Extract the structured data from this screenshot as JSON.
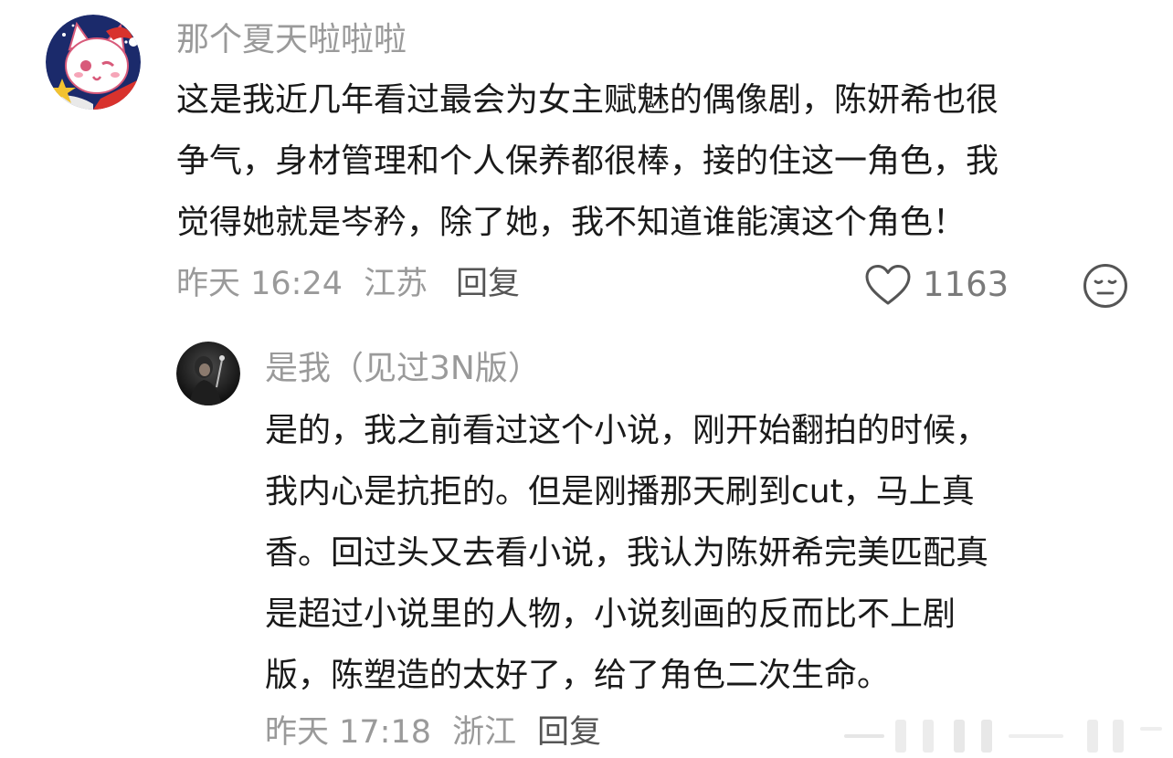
{
  "comment": {
    "username": "那个夏天啦啦啦",
    "lines": [
      "这是我近几年看过最会为女主赋魅的偶像剧，陈妍希也很",
      "争气，身材管理和个人保养都很棒，接的住这一角色，我",
      "觉得她就是岑矜，除了她，我不知道谁能演这个角色！"
    ],
    "time": "昨天 16:24",
    "location": "江苏",
    "reply_label": "回复",
    "like_count": "1163",
    "avatar_icon": "cat-avatar-icon",
    "like_icon": "heart-icon",
    "emoji_icon": "neutral-face-icon"
  },
  "reply": {
    "username": "是我（见过3N版）",
    "lines": [
      "是的，我之前看过这个小说，刚开始翻拍的时候，",
      "我内心是抗拒的。但是刚播那天刷到cut，马上真",
      "香。回过头又去看小说，我认为陈妍希完美匹配真",
      "是超过小说里的人物，小说刻画的反而比不上剧",
      "版，陈塑造的太好了，给了角色二次生命。"
    ],
    "time": "昨天 17:18",
    "location": "浙江",
    "reply_label": "回复",
    "avatar_icon": "photo-avatar-icon"
  },
  "colors": {
    "text": "#1a1a1a",
    "meta": "#9a9a9a",
    "icon": "#555555"
  }
}
